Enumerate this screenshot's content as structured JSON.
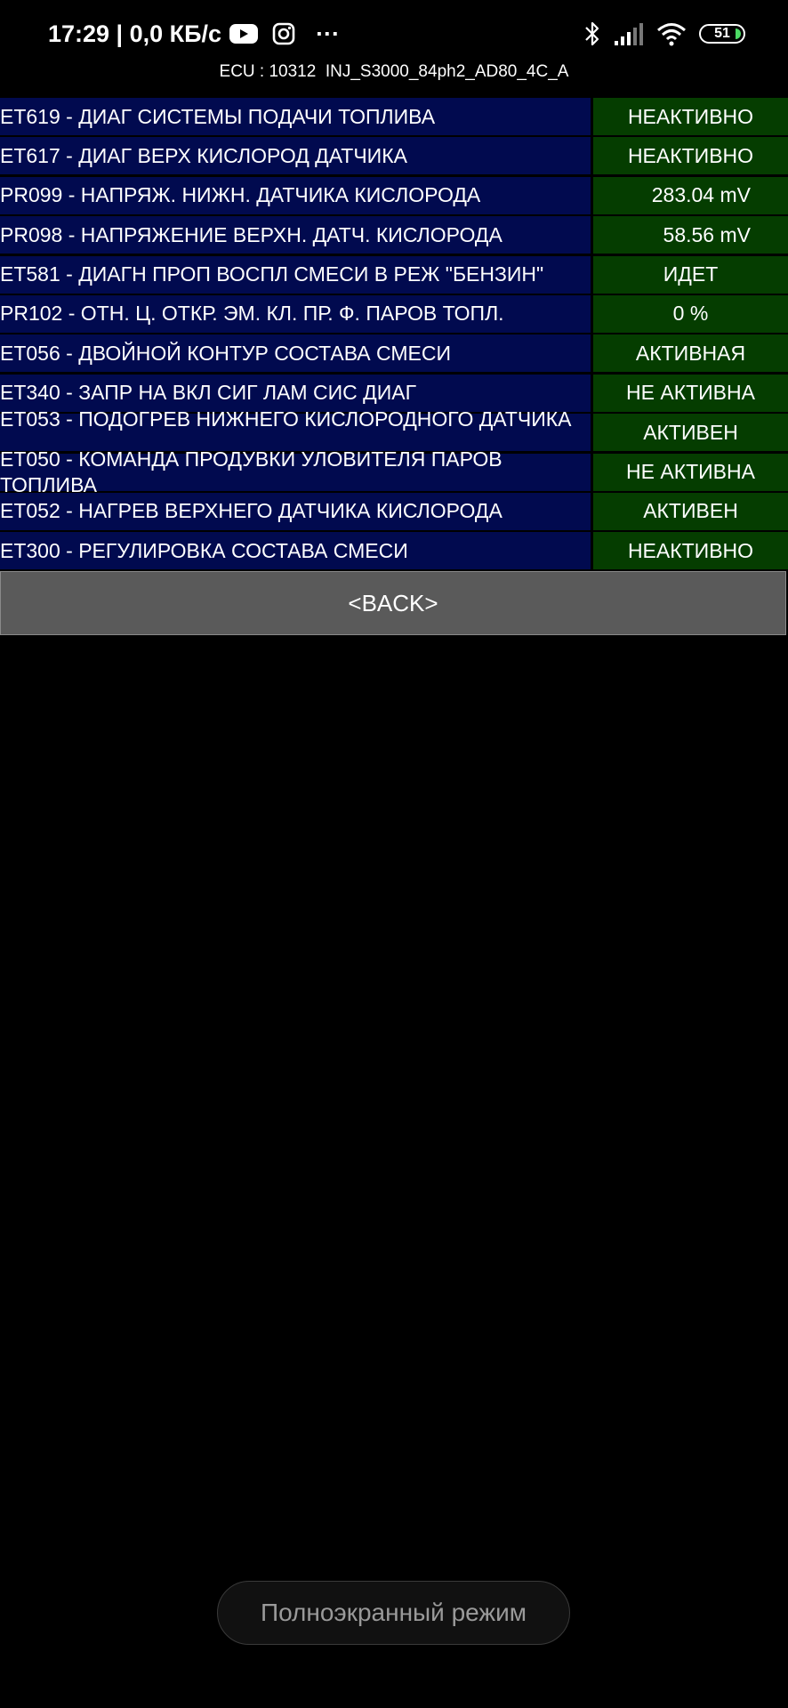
{
  "status_bar": {
    "time_and_speed": "17:29 | 0,0 КБ/с",
    "more_indicator": "···",
    "battery_level": "51",
    "battery_color": "#4cd964",
    "left_icons": [
      "youtube-icon",
      "instagram-icon"
    ],
    "right_icons": [
      "bluetooth-icon",
      "cellular-signal-icon",
      "wifi-icon",
      "battery-icon"
    ]
  },
  "ecu": {
    "line": "ECU : 10312  INJ_S3000_84ph2_AD80_4C_A"
  },
  "params": [
    {
      "name": "ET619 - ДИАГ СИСТЕМЫ ПОДАЧИ ТОПЛИВА",
      "value": "НЕАКТИВНО"
    },
    {
      "name": "ET617 - ДИАГ ВЕРХ КИСЛОРОД ДАТЧИКА",
      "value": "НЕАКТИВНО"
    },
    {
      "name": "PR099 - НАПРЯЖ. НИЖН. ДАТЧИКА КИСЛОРОДА",
      "value": "283.04 mV"
    },
    {
      "name": "PR098 - НАПРЯЖЕНИЕ ВЕРХН. ДАТЧ. КИСЛОРОДА",
      "value": "58.56 mV"
    },
    {
      "name": "ET581 - ДИАГН ПРОП ВОСПЛ СМЕСИ В РЕЖ \"БЕНЗИН\"",
      "value": "ИДЕТ"
    },
    {
      "name": "PR102 - ОТН. Ц. ОТКР. ЭМ. КЛ. ПР. Ф. ПАРОВ ТОПЛ.",
      "value": "0 %"
    },
    {
      "name": "ET056 - ДВОЙНОЙ КОНТУР СОСТАВА СМЕСИ",
      "value": "АКТИВНАЯ"
    },
    {
      "name": "ET340 - ЗАПР НА ВКЛ СИГ ЛАМ СИС ДИАГ",
      "value": "НЕ АКТИВНА"
    },
    {
      "name": "ET053 - ПОДОГРЕВ НИЖНЕГО КИСЛОРОДНОГО ДАТЧИКА",
      "value": "АКТИВЕН"
    },
    {
      "name": "ET050 - КОМАНДА ПРОДУВКИ УЛОВИТЕЛЯ ПАРОВ ТОПЛИВА",
      "value": "НЕ АКТИВНА"
    },
    {
      "name": "ET052 - НАГРЕВ ВЕРХНЕГО ДАТЧИКА КИСЛОРОДА",
      "value": "АКТИВЕН"
    },
    {
      "name": "ET300 - РЕГУЛИРОВКА СОСТАВА СМЕСИ",
      "value": "НЕАКТИВНО"
    }
  ],
  "colors": {
    "name_background": "#010a4f",
    "value_background": "#053d00",
    "back_button_background": "#5a5a5a"
  },
  "back_button": {
    "label": "<BACK>"
  },
  "toast": {
    "label": "Полноэкранный режим"
  }
}
